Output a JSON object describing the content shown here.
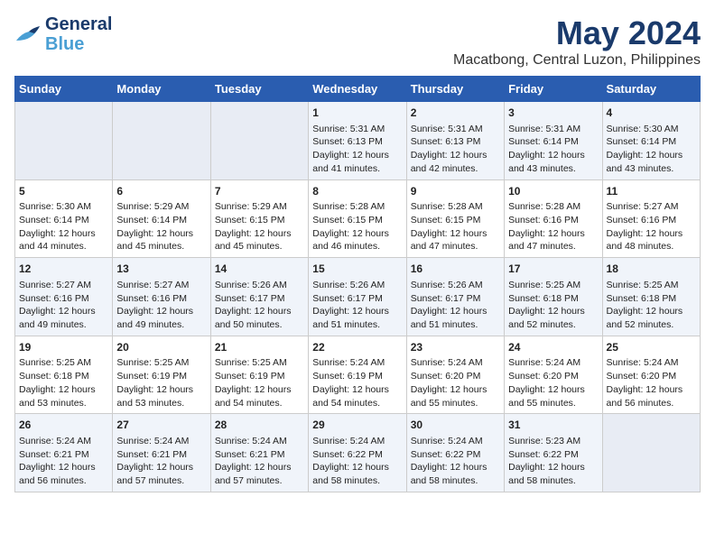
{
  "header": {
    "logo_line1": "General",
    "logo_line2": "Blue",
    "title": "May 2024",
    "subtitle": "Macatbong, Central Luzon, Philippines"
  },
  "days_of_week": [
    "Sunday",
    "Monday",
    "Tuesday",
    "Wednesday",
    "Thursday",
    "Friday",
    "Saturday"
  ],
  "weeks": [
    [
      {
        "day": "",
        "content": ""
      },
      {
        "day": "",
        "content": ""
      },
      {
        "day": "",
        "content": ""
      },
      {
        "day": "1",
        "content": "Sunrise: 5:31 AM\nSunset: 6:13 PM\nDaylight: 12 hours\nand 41 minutes."
      },
      {
        "day": "2",
        "content": "Sunrise: 5:31 AM\nSunset: 6:13 PM\nDaylight: 12 hours\nand 42 minutes."
      },
      {
        "day": "3",
        "content": "Sunrise: 5:31 AM\nSunset: 6:14 PM\nDaylight: 12 hours\nand 43 minutes."
      },
      {
        "day": "4",
        "content": "Sunrise: 5:30 AM\nSunset: 6:14 PM\nDaylight: 12 hours\nand 43 minutes."
      }
    ],
    [
      {
        "day": "5",
        "content": "Sunrise: 5:30 AM\nSunset: 6:14 PM\nDaylight: 12 hours\nand 44 minutes."
      },
      {
        "day": "6",
        "content": "Sunrise: 5:29 AM\nSunset: 6:14 PM\nDaylight: 12 hours\nand 45 minutes."
      },
      {
        "day": "7",
        "content": "Sunrise: 5:29 AM\nSunset: 6:15 PM\nDaylight: 12 hours\nand 45 minutes."
      },
      {
        "day": "8",
        "content": "Sunrise: 5:28 AM\nSunset: 6:15 PM\nDaylight: 12 hours\nand 46 minutes."
      },
      {
        "day": "9",
        "content": "Sunrise: 5:28 AM\nSunset: 6:15 PM\nDaylight: 12 hours\nand 47 minutes."
      },
      {
        "day": "10",
        "content": "Sunrise: 5:28 AM\nSunset: 6:16 PM\nDaylight: 12 hours\nand 47 minutes."
      },
      {
        "day": "11",
        "content": "Sunrise: 5:27 AM\nSunset: 6:16 PM\nDaylight: 12 hours\nand 48 minutes."
      }
    ],
    [
      {
        "day": "12",
        "content": "Sunrise: 5:27 AM\nSunset: 6:16 PM\nDaylight: 12 hours\nand 49 minutes."
      },
      {
        "day": "13",
        "content": "Sunrise: 5:27 AM\nSunset: 6:16 PM\nDaylight: 12 hours\nand 49 minutes."
      },
      {
        "day": "14",
        "content": "Sunrise: 5:26 AM\nSunset: 6:17 PM\nDaylight: 12 hours\nand 50 minutes."
      },
      {
        "day": "15",
        "content": "Sunrise: 5:26 AM\nSunset: 6:17 PM\nDaylight: 12 hours\nand 51 minutes."
      },
      {
        "day": "16",
        "content": "Sunrise: 5:26 AM\nSunset: 6:17 PM\nDaylight: 12 hours\nand 51 minutes."
      },
      {
        "day": "17",
        "content": "Sunrise: 5:25 AM\nSunset: 6:18 PM\nDaylight: 12 hours\nand 52 minutes."
      },
      {
        "day": "18",
        "content": "Sunrise: 5:25 AM\nSunset: 6:18 PM\nDaylight: 12 hours\nand 52 minutes."
      }
    ],
    [
      {
        "day": "19",
        "content": "Sunrise: 5:25 AM\nSunset: 6:18 PM\nDaylight: 12 hours\nand 53 minutes."
      },
      {
        "day": "20",
        "content": "Sunrise: 5:25 AM\nSunset: 6:19 PM\nDaylight: 12 hours\nand 53 minutes."
      },
      {
        "day": "21",
        "content": "Sunrise: 5:25 AM\nSunset: 6:19 PM\nDaylight: 12 hours\nand 54 minutes."
      },
      {
        "day": "22",
        "content": "Sunrise: 5:24 AM\nSunset: 6:19 PM\nDaylight: 12 hours\nand 54 minutes."
      },
      {
        "day": "23",
        "content": "Sunrise: 5:24 AM\nSunset: 6:20 PM\nDaylight: 12 hours\nand 55 minutes."
      },
      {
        "day": "24",
        "content": "Sunrise: 5:24 AM\nSunset: 6:20 PM\nDaylight: 12 hours\nand 55 minutes."
      },
      {
        "day": "25",
        "content": "Sunrise: 5:24 AM\nSunset: 6:20 PM\nDaylight: 12 hours\nand 56 minutes."
      }
    ],
    [
      {
        "day": "26",
        "content": "Sunrise: 5:24 AM\nSunset: 6:21 PM\nDaylight: 12 hours\nand 56 minutes."
      },
      {
        "day": "27",
        "content": "Sunrise: 5:24 AM\nSunset: 6:21 PM\nDaylight: 12 hours\nand 57 minutes."
      },
      {
        "day": "28",
        "content": "Sunrise: 5:24 AM\nSunset: 6:21 PM\nDaylight: 12 hours\nand 57 minutes."
      },
      {
        "day": "29",
        "content": "Sunrise: 5:24 AM\nSunset: 6:22 PM\nDaylight: 12 hours\nand 58 minutes."
      },
      {
        "day": "30",
        "content": "Sunrise: 5:24 AM\nSunset: 6:22 PM\nDaylight: 12 hours\nand 58 minutes."
      },
      {
        "day": "31",
        "content": "Sunrise: 5:23 AM\nSunset: 6:22 PM\nDaylight: 12 hours\nand 58 minutes."
      },
      {
        "day": "",
        "content": ""
      }
    ]
  ]
}
